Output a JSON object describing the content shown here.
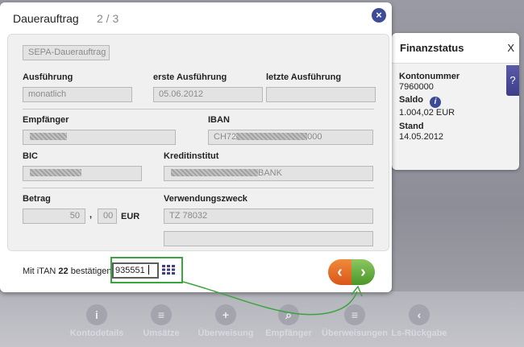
{
  "bottom_nav": [
    {
      "label": "Kontodetails",
      "icon": "i"
    },
    {
      "label": "Umsätze",
      "icon": "≡"
    },
    {
      "label": "Überweisung",
      "icon": "+"
    },
    {
      "label": "Empfänger",
      "icon": "⌕"
    },
    {
      "label": "Überweisungen",
      "icon": "≡"
    },
    {
      "label": "Ls-Rückgabe",
      "icon": "‹"
    }
  ],
  "status_panel": {
    "title": "Finanzstatus",
    "close": "X",
    "account_label": "Kontonummer",
    "account_value": "7960000",
    "balance_label": "Saldo",
    "balance_value": "1.004,02 EUR",
    "date_label": "Stand",
    "date_value": "14.05.2012",
    "help": "?"
  },
  "dialog": {
    "title": "Dauerauftrag",
    "step": "2 / 3",
    "close": "×",
    "type_value": "SEPA-Dauerauftrag",
    "labels": {
      "frequency": "Ausführung",
      "first_execution": "erste Ausführung",
      "last_execution": "letzte Ausführung",
      "recipient": "Empfänger",
      "iban": "IBAN",
      "bic": "BIC",
      "bank": "Kreditinstitut",
      "amount": "Betrag",
      "purpose": "Verwendungszweck"
    },
    "values": {
      "frequency": "monatlich",
      "first_execution": "05.06.2012",
      "last_execution": "",
      "iban_prefix": "CH72",
      "iban_suffix": "000",
      "bank_suffix": "BANK",
      "amount_euros": "50",
      "amount_sep": ",",
      "amount_cents": "00",
      "currency": "EUR",
      "purpose_line1": "TZ 78032",
      "purpose_line2": ""
    },
    "footer": {
      "prefix": "Mit iTAN",
      "itan_number": "22",
      "suffix": "bestätigen",
      "itan_value": "935551"
    },
    "nav": {
      "back": "‹",
      "forward": "›"
    }
  }
}
